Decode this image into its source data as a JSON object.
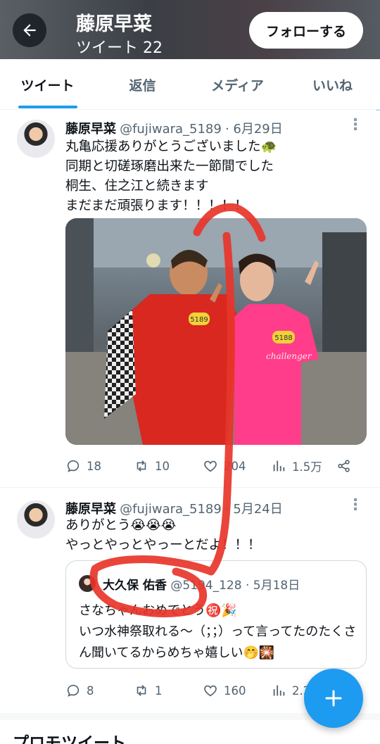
{
  "header": {
    "title": "藤原早菜",
    "subtitle": "ツイート 22",
    "follow_label": "フォローする",
    "background": "#45494f"
  },
  "tabs": [
    {
      "label": "ツイート",
      "active": true
    },
    {
      "label": "返信",
      "active": false
    },
    {
      "label": "メディア",
      "active": false
    },
    {
      "label": "いいね",
      "active": false
    }
  ],
  "tweets": [
    {
      "name": "藤原早菜",
      "handle": "@fujiwara_5189",
      "date": "· 6月29日",
      "text": "丸亀応援ありがとうございました🐢\n同期と切磋琢磨出来た一節間でした\n桐生、住之江と続きます\nまだまだ頑張ります！！！！！",
      "photo": {
        "bib_left": "5189",
        "bib_right": "5188",
        "shirt_text": "challenger"
      },
      "replies": "18",
      "retweets": "10",
      "likes": "204",
      "views": "1.5万"
    },
    {
      "name": "藤原早菜",
      "handle": "@fujiwara_5189",
      "date": "· 5月24日",
      "text": "ありがとう😭😭😭\nやっとやっとやっーとだよ！！！",
      "replies": "8",
      "retweets": "1",
      "likes": "160",
      "views": "2.2",
      "quote": {
        "name": "大久保 佑香",
        "handle": "@5194_128",
        "date": "· 5月18日",
        "text": "さなちゃんおめでとう㊗️🎉\nいつ水神祭取れる〜（；；）って言ってたのたくさん聞いてるからめちゃ嬉しい🤭🎇"
      }
    }
  ],
  "promo_title": "プロモツイート",
  "colors": {
    "accent": "#1d9bf0",
    "scribble": "#e8352a"
  }
}
